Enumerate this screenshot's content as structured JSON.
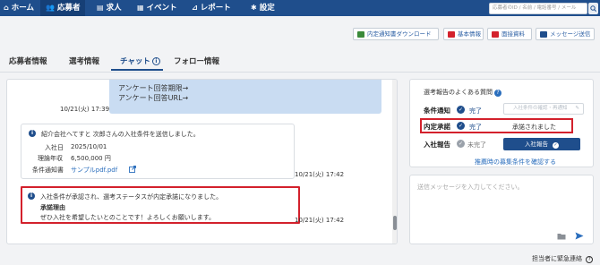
{
  "nav": {
    "items": [
      "ホーム",
      "応募者",
      "求人",
      "イベント",
      "レポート",
      "設定"
    ],
    "search_placeholder": "応募者のID / 名前 / 電話番号 / メール"
  },
  "toolbar": {
    "buttons": [
      "内定通知書ダウンロード",
      "基本情報",
      "面接資料",
      "メッセージ送信"
    ],
    "icon_colors": [
      "#3a8a3a",
      "#d3212c",
      "#d3212c",
      "#1f4e8c"
    ]
  },
  "tabs": [
    "応募者情報",
    "選考情報",
    "チャット",
    "フォロー情報"
  ],
  "chat": {
    "bubble_lines": [
      "アンケート回答期限→",
      "アンケート回答URL→"
    ],
    "bubble_time": "10/21(火) 17:39",
    "card1": {
      "header": "紹介会社へてすと 次郎さんの入社条件を送信しました。",
      "rows": [
        {
          "label": "入社日",
          "value": "2025/10/01"
        },
        {
          "label": "理論年収",
          "value": "6,500,000 円"
        }
      ],
      "doc_label": "条件通知書",
      "doc_link": "サンプルpdf.pdf",
      "time": "10/21(火) 17:42"
    },
    "card2": {
      "header": "入社条件が承認され、選考ステータスが内定承諾になりました。",
      "reason_title": "承諾理由",
      "reason_text": "ぜひ入社を希望したいとのことです！よろしくお願いします。",
      "time": "10/21(火) 17:42"
    }
  },
  "side": {
    "title": "選考報告のよくある質問",
    "rows": [
      {
        "label": "条件通知",
        "status": "完了",
        "action": "入社条件の確認・再通知"
      },
      {
        "label": "内定承諾",
        "status": "完了",
        "action": "承諾されました"
      },
      {
        "label": "入社報告",
        "status": "未完了",
        "action": "入社報告"
      }
    ],
    "link": "推薦時の募集条件を確認する"
  },
  "compose": {
    "placeholder": "送信メッセージを入力してください。"
  },
  "footer": "担当者に緊急連絡"
}
